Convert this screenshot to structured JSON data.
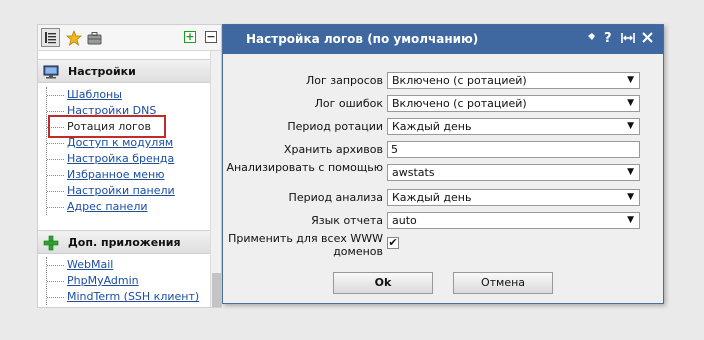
{
  "sidebar": {
    "sections": [
      {
        "title": "Настройки",
        "items": [
          "Шаблоны",
          "Настройки DNS",
          "Ротация логов",
          "Доступ к модулям",
          "Настройка бренда",
          "Избранное меню",
          "Настройки панели",
          "Адрес панели"
        ],
        "selected_item": "Ротация логов"
      },
      {
        "title": "Доп. приложения",
        "items": [
          "WebMail",
          "PhpMyAdmin",
          "MindTerm (SSH клиент)"
        ]
      }
    ]
  },
  "dialog": {
    "title": "Настройка логов (по умолчанию)",
    "title_icons": [
      "pin-icon",
      "help-icon",
      "resize-icon",
      "close-icon"
    ],
    "fields": [
      {
        "label": "Лог запросов",
        "type": "select",
        "value": "Включено (с ротацией)"
      },
      {
        "label": "Лог ошибок",
        "type": "select",
        "value": "Включено (с ротацией)"
      },
      {
        "label": "Период ротации",
        "type": "select",
        "value": "Каждый день"
      },
      {
        "label": "Хранить архивов",
        "type": "input",
        "value": "5"
      },
      {
        "label": "Анализировать с помощью",
        "type": "select",
        "value": "awstats"
      },
      {
        "label": "Период анализа",
        "type": "select",
        "value": "Каждый день"
      },
      {
        "label": "Язык отчета",
        "type": "select",
        "value": "auto"
      },
      {
        "label": "Применить для всех WWW доменов",
        "type": "checkbox",
        "value": "checked"
      }
    ],
    "buttons": {
      "ok": "Ok",
      "cancel": "Отмена"
    }
  },
  "colors": {
    "title_bar": "#3f68a0",
    "link": "#1d4ea0",
    "selection_border": "#c02b2b"
  }
}
